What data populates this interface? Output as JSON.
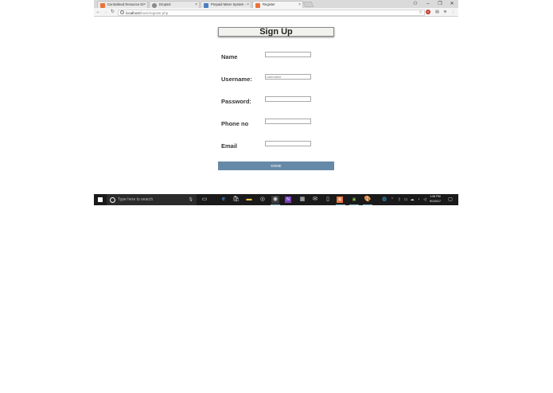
{
  "browser": {
    "tabs": [
      {
        "title": "Centralised Resource Di",
        "favicon_color": "#e8743b",
        "active": false
      },
      {
        "title": "Dropsol",
        "favicon_color": "#888888",
        "active": false
      },
      {
        "title": "Prepaid Meter System -",
        "favicon_color": "#4a7fc0",
        "active": false
      },
      {
        "title": "Register",
        "favicon_color": "#e8743b",
        "active": true
      }
    ],
    "tab_close": "×",
    "url_host": "localhost",
    "url_path": "/hack/register.php",
    "info_icon": "i",
    "star_icon": "☆",
    "back_icon": "←",
    "forward_icon": "→",
    "reload_icon": "↻",
    "minimize_icon": "–",
    "maximize_icon": "❐",
    "close_icon": "✕",
    "profile_icon": "⚇",
    "menu_icon": "⋮"
  },
  "form": {
    "title": "Sign Up",
    "fields": [
      {
        "label": "Name",
        "value": "",
        "placeholder": ""
      },
      {
        "label": "Username:",
        "value": "",
        "placeholder": "Username"
      },
      {
        "label": "Password:",
        "value": "",
        "placeholder": ""
      },
      {
        "label": "Phone no",
        "value": "",
        "placeholder": ""
      },
      {
        "label": "Email",
        "value": "",
        "placeholder": ""
      }
    ],
    "submit_label": "DONE",
    "button_color": "#6789a8"
  },
  "taskbar": {
    "search_placeholder": "Type here to search",
    "time": "1:06 PM",
    "date": "9/1/2017"
  }
}
